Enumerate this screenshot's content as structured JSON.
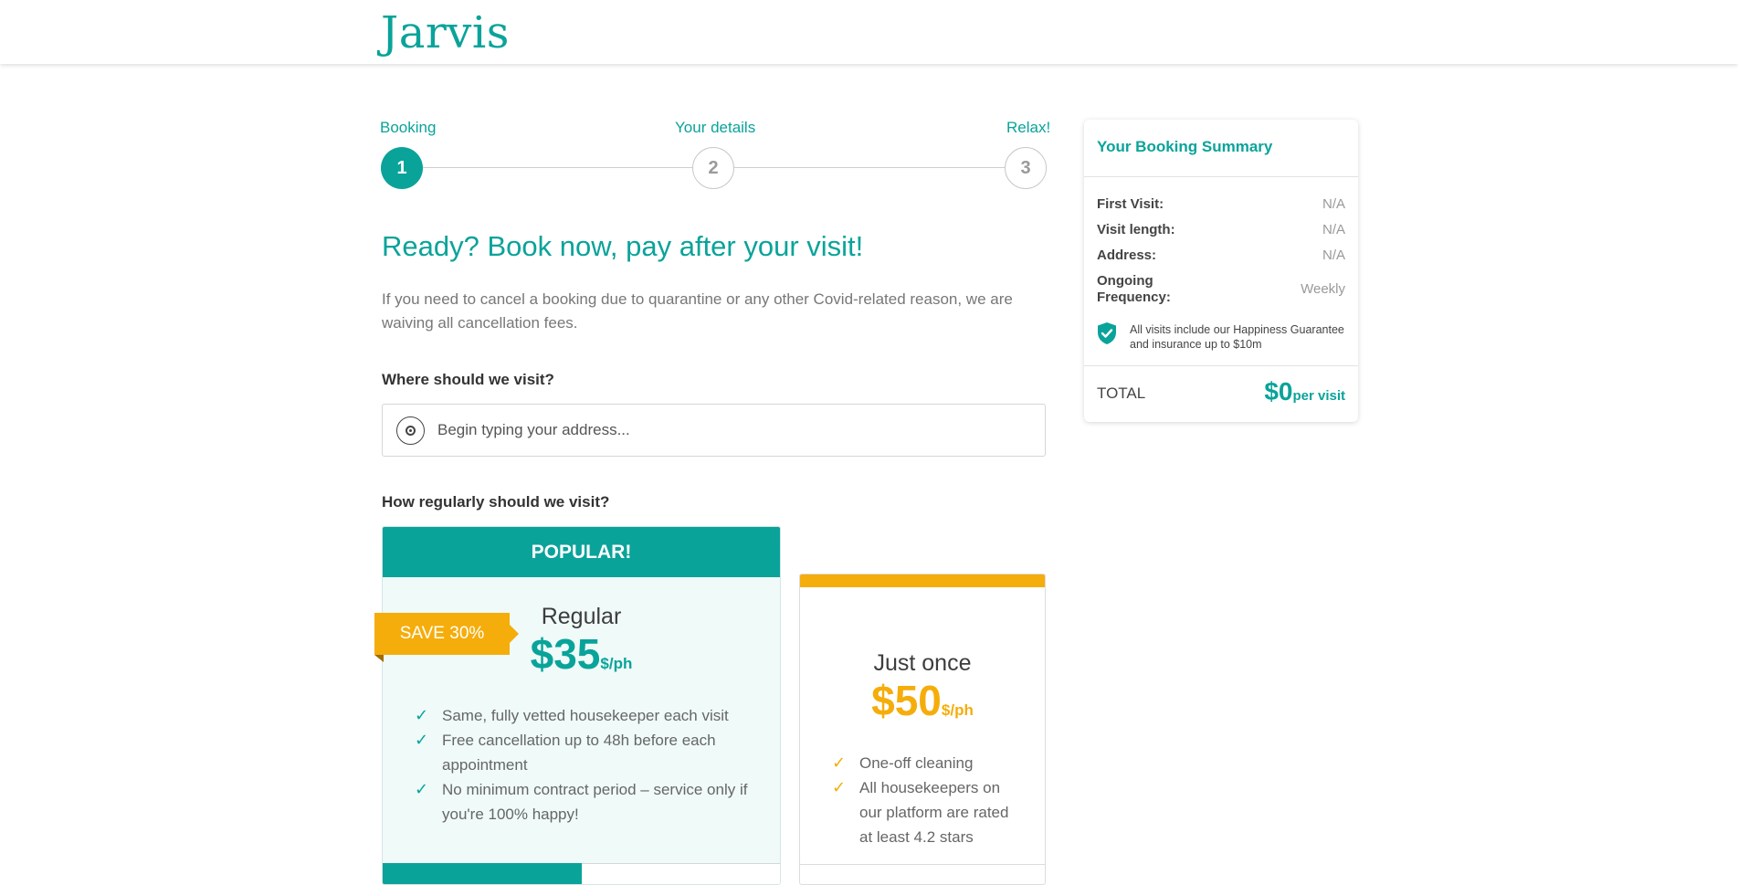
{
  "brand": {
    "name": "Jarvis",
    "color": "#0aa39a"
  },
  "stepper": {
    "steps": [
      {
        "label": "Booking",
        "number": "1",
        "active": true
      },
      {
        "label": "Your details",
        "number": "2",
        "active": false
      },
      {
        "label": "Relax!",
        "number": "3",
        "active": false
      }
    ]
  },
  "headline": "Ready? Book now, pay after your visit!",
  "intro": "If you need to cancel a booking due to quarantine or any other Covid-related reason, we are waiving all cancellation fees.",
  "address": {
    "label": "Where should we visit?",
    "placeholder": "Begin typing your address...",
    "value": "",
    "icon": "location-target-icon"
  },
  "frequency": {
    "label": "How regularly should we visit?",
    "plans": [
      {
        "id": "regular",
        "banner": "POPULAR!",
        "badge": "SAVE 30%",
        "name": "Regular",
        "price": "$35",
        "unit": "$/ph",
        "accent": "#0aa39a",
        "features": [
          "Same, fully vetted housekeeper each visit",
          "Free cancellation up to 48h before each appointment",
          "No minimum contract period – service only if you're 100% happy!"
        ]
      },
      {
        "id": "once",
        "name": "Just once",
        "price": "$50",
        "unit": "$/ph",
        "accent": "#f5ad0b",
        "features": [
          "One-off cleaning",
          "All housekeepers on our platform are rated at least 4.2 stars"
        ]
      }
    ]
  },
  "summary": {
    "title": "Your Booking Summary",
    "rows": [
      {
        "label": "First Visit:",
        "value": "N/A"
      },
      {
        "label": "Visit length:",
        "value": "N/A"
      },
      {
        "label": "Address:",
        "value": "N/A"
      },
      {
        "label": "Ongoing Frequency:",
        "value": "Weekly"
      }
    ],
    "guarantee": "All visits include our Happiness Guarantee and insurance up to $10m",
    "total_label": "TOTAL",
    "total_value": "$0",
    "total_unit": "per visit"
  }
}
